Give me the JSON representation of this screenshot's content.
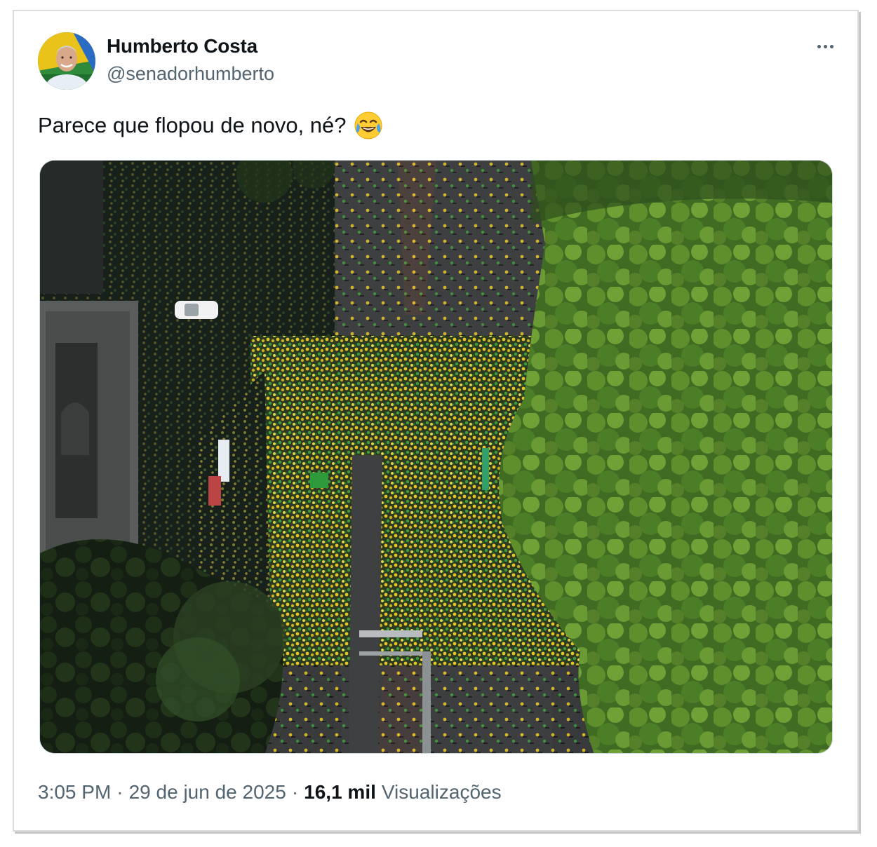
{
  "author": {
    "name": "Humberto Costa",
    "handle": "@senadorhumberto",
    "avatar_icon": "profile-photo-avatar"
  },
  "more_icon": "more-horizontal-icon",
  "tweet": {
    "text": "Parece que flopou de novo, né?",
    "emoji_icon": "face-with-tears-of-joy-icon"
  },
  "media": {
    "type": "photo",
    "icon": "aerial-crowd-photo"
  },
  "meta": {
    "time": "3:05 PM",
    "separator": "·",
    "date": "29 de jun de 2025",
    "views_count": "16,1 mil",
    "views_label": "Visualizações"
  },
  "colors": {
    "text_primary": "#0f1419",
    "text_secondary": "#536471",
    "border": "#cfd9de"
  }
}
